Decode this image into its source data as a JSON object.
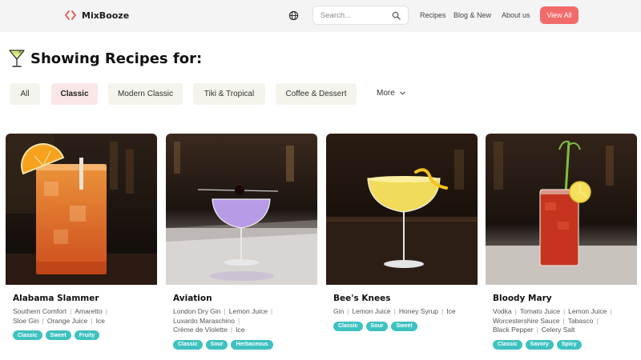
{
  "brand": {
    "name": "MixBooze"
  },
  "search": {
    "placeholder": "Search..."
  },
  "nav": {
    "recipes": "Recipes",
    "blog": "Blog & New",
    "about": "About us",
    "view_all": "View All"
  },
  "page": {
    "title": "Showing Recipes for:"
  },
  "filters": [
    "All",
    "Classic",
    "Modern Classic",
    "Tiki & Tropical",
    "Coffee & Dessert"
  ],
  "active_filter": "Classic",
  "more_label": "More",
  "colors": {
    "accent": "#f16b6b",
    "tag": "#3ec1c1",
    "active_pill": "#fbe6e7",
    "pill": "#f4f4ec"
  },
  "recipes": [
    {
      "name": "Alabama Slammer",
      "ingredients": [
        "Southern Comfort",
        "Amaretto",
        "Sloe Gin",
        "Orange Juice",
        "Ice"
      ],
      "tags": [
        "Classic",
        "Sweet",
        "Fruity"
      ]
    },
    {
      "name": "Aviation",
      "ingredients": [
        "London Dry Gin",
        "Lemon Juice",
        "Luxardo Maraschino",
        "Crème de Violette",
        "Ice"
      ],
      "tags": [
        "Classic",
        "Sour",
        "Herbaceous"
      ]
    },
    {
      "name": "Bee's Knees",
      "ingredients": [
        "Gin",
        "Lemon Juice",
        "Honey Syrup",
        "Ice"
      ],
      "tags": [
        "Classic",
        "Sour",
        "Sweet"
      ]
    },
    {
      "name": "Bloody Mary",
      "ingredients": [
        "Vodka",
        "Tomato Juice",
        "Lemon Juice",
        "Worcestershire Sauce",
        "Tabasco",
        "Black Pepper",
        "Celery Salt"
      ],
      "tags": [
        "Classic",
        "Savory",
        "Spicy"
      ]
    }
  ]
}
